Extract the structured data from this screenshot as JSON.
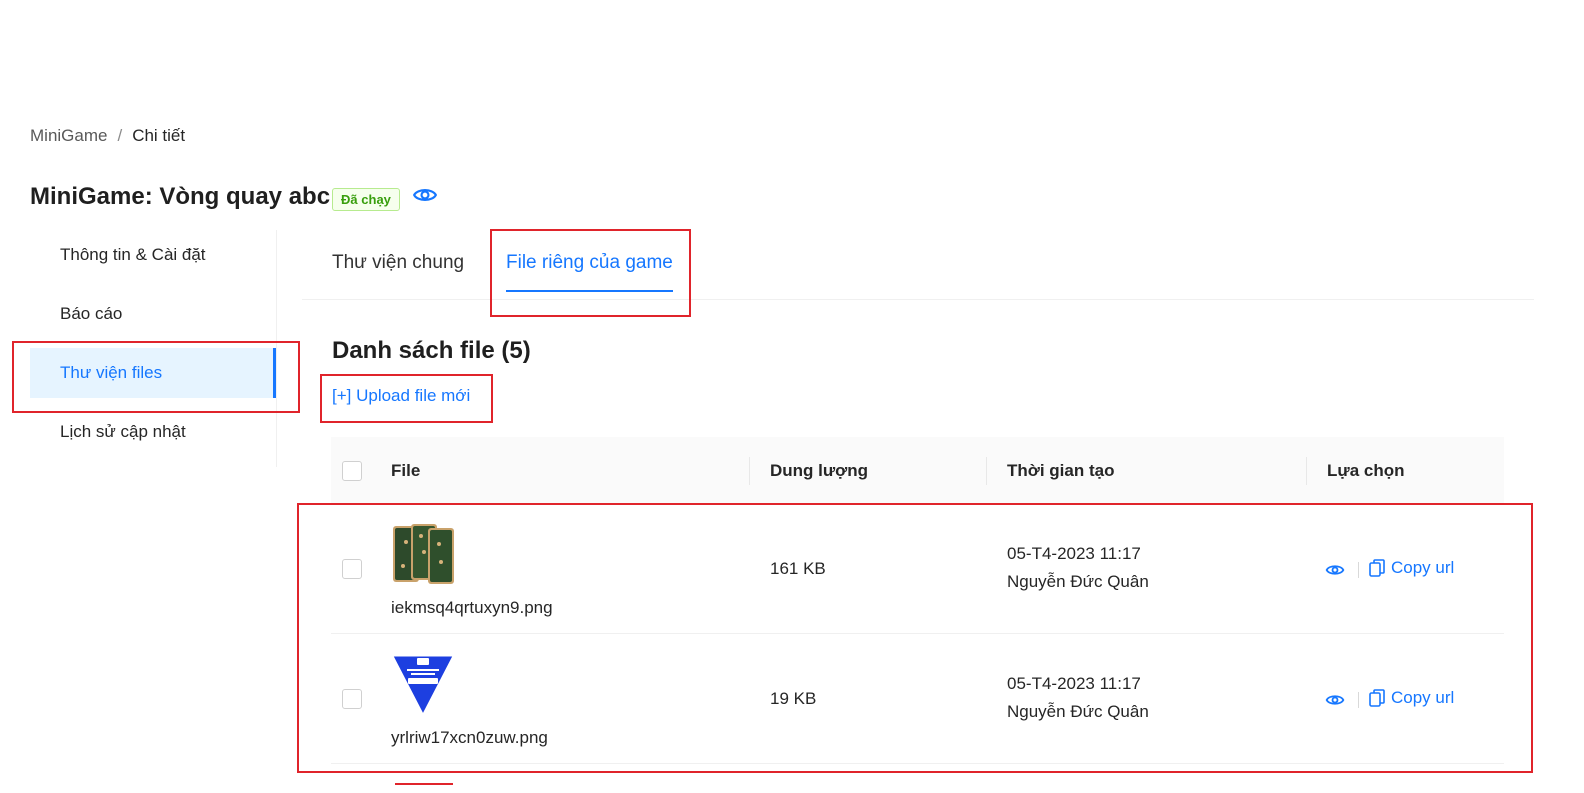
{
  "breadcrumb": {
    "root": "MiniGame",
    "separator": "/",
    "current": "Chi tiết"
  },
  "page": {
    "title": "MiniGame: Vòng quay abc",
    "status": "Đã chạy"
  },
  "sidebar": {
    "items": [
      {
        "label": "Thông tin & Cài đặt"
      },
      {
        "label": "Báo cáo"
      },
      {
        "label": "Thư viện files"
      },
      {
        "label": "Lịch sử cập nhật"
      }
    ]
  },
  "tabs": [
    {
      "label": "Thư viện chung"
    },
    {
      "label": "File riêng của game"
    }
  ],
  "files": {
    "title": "Danh sách file (5)",
    "upload_label": "[+] Upload file mới",
    "columns": {
      "file": "File",
      "size": "Dung lượng",
      "created": "Thời gian tạo",
      "actions": "Lựa chọn"
    },
    "rows": [
      {
        "name": "iekmsq4qrtuxyn9.png",
        "size": "161 KB",
        "time": "05-T4-2023 11:17",
        "author": "Nguyễn Đức Quân",
        "copy_label": "Copy url"
      },
      {
        "name": "yrlriw17xcn0zuw.png",
        "size": "19 KB",
        "time": "05-T4-2023 11:17",
        "author": "Nguyễn Đức Quân",
        "copy_label": "Copy url"
      }
    ]
  },
  "colors": {
    "accent": "#1677ff",
    "highlight": "#e0242b",
    "success": "#389e0d"
  }
}
